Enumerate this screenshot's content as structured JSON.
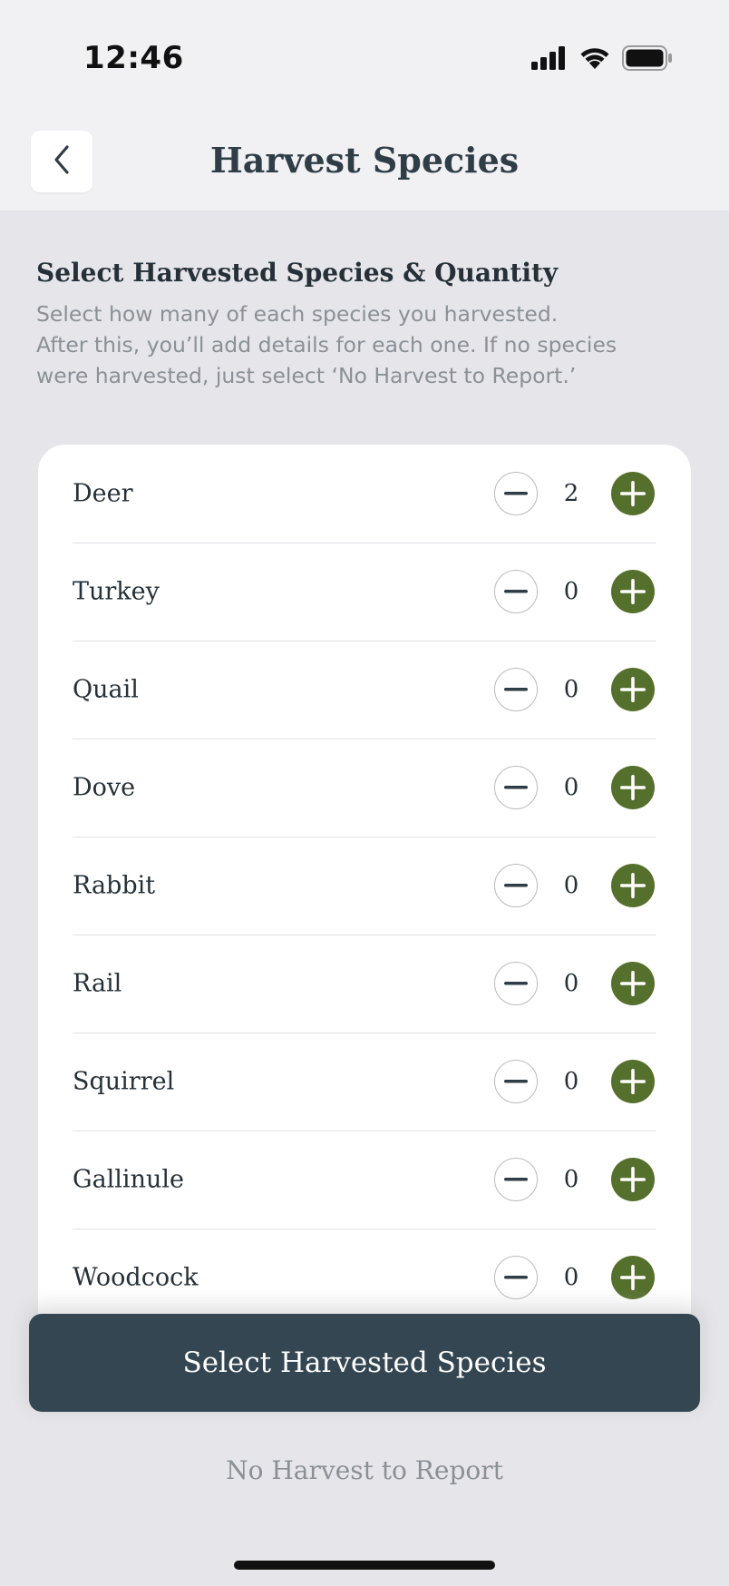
{
  "status_bar": {
    "time": "12:46"
  },
  "header": {
    "title": "Harvest Species"
  },
  "intro": {
    "heading": "Select Harvested Species & Quantity",
    "line1": "Select how many of each species you harvested.",
    "line2": "After this, you’ll add details for each one. If no species",
    "line3": "were harvested, just select ‘No Harvest to Report.’"
  },
  "species": [
    {
      "name": "Deer",
      "count": "2"
    },
    {
      "name": "Turkey",
      "count": "0"
    },
    {
      "name": "Quail",
      "count": "0"
    },
    {
      "name": "Dove",
      "count": "0"
    },
    {
      "name": "Rabbit",
      "count": "0"
    },
    {
      "name": "Rail",
      "count": "0"
    },
    {
      "name": "Squirrel",
      "count": "0"
    },
    {
      "name": "Gallinule",
      "count": "0"
    },
    {
      "name": "Woodcock",
      "count": "0"
    }
  ],
  "actions": {
    "primary_label": "Select Harvested Species",
    "secondary_label": "No Harvest to Report"
  },
  "colors": {
    "accent_green": "#556f2c",
    "primary_button": "#344651",
    "text_dark": "#253038",
    "text_muted": "#8a9096"
  },
  "icons": {
    "back": "chevron-left-icon",
    "decrement": "minus-icon",
    "increment": "plus-icon",
    "signal": "cellular-signal-icon",
    "wifi": "wifi-icon",
    "battery": "battery-icon"
  }
}
